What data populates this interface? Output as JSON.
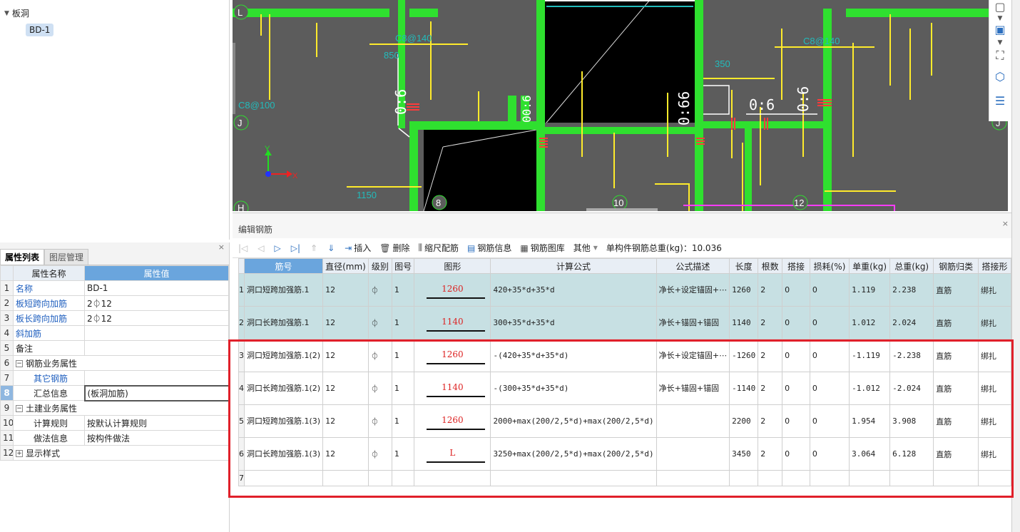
{
  "tree": {
    "root": "板洞",
    "child": "BD-1"
  },
  "props": {
    "tabs": [
      "属性列表",
      "图层管理"
    ],
    "close": "×",
    "header": {
      "name": "属性名称",
      "value": "属性值"
    },
    "rows": [
      {
        "n": "1",
        "name": "名称",
        "value": "BD-1"
      },
      {
        "n": "2",
        "name": "板短跨向加筋",
        "value": "2⏀12"
      },
      {
        "n": "3",
        "name": "板长跨向加筋",
        "value": "2⏀12"
      },
      {
        "n": "4",
        "name": "斜加筋",
        "value": ""
      },
      {
        "n": "5",
        "name": "备注",
        "value": ""
      },
      {
        "n": "6",
        "name": "钢筋业务属性",
        "value": "",
        "exp": "−"
      },
      {
        "n": "7",
        "name": "其它钢筋",
        "value": ""
      },
      {
        "n": "8",
        "name": "汇总信息",
        "value": "(板洞加筋)"
      },
      {
        "n": "9",
        "name": "土建业务属性",
        "value": "",
        "exp": "−"
      },
      {
        "n": "10",
        "name": "计算规则",
        "value": "按默认计算规则"
      },
      {
        "n": "11",
        "name": "做法信息",
        "value": "按构件做法"
      },
      {
        "n": "12",
        "name": "显示样式",
        "value": "",
        "exp": "+"
      }
    ]
  },
  "cad": {
    "axes": {
      "L": "L",
      "J": "J",
      "H": "H",
      "n8": "8",
      "n10": "10",
      "n12": "12",
      "x": "X",
      "y": "Y"
    },
    "dims": {
      "d1": "0:6",
      "d2": "0:66",
      "d3": "0:6",
      "d4": "0:6",
      "d5": "00:6"
    },
    "texts": {
      "t1": "850",
      "t2": "C8@140",
      "t3": "C8@100",
      "t4": "1150",
      "t5": "350",
      "t6": "C8@140"
    }
  },
  "editor": {
    "title": "编辑钢筋",
    "close": "×",
    "toolbar": {
      "insert": "插入",
      "delete": "删除",
      "scale": "缩尺配筋",
      "info": "钢筋信息",
      "library": "钢筋图库",
      "other": "其他",
      "total": "单构件钢筋总重(kg)：10.036"
    },
    "columns": [
      "筋号",
      "直径(mm)",
      "级别",
      "图号",
      "图形",
      "计算公式",
      "公式描述",
      "长度",
      "根数",
      "搭接",
      "损耗(%)",
      "单重(kg)",
      "总重(kg)",
      "钢筋归类",
      "搭接形"
    ],
    "rows": [
      {
        "n": "1",
        "name": "洞口短跨加强筋.1",
        "dia": "12",
        "grade": "⏀",
        "fig": "1",
        "shape": "1260",
        "formula": "420+35*d+35*d",
        "desc": "净长+设定锚固+⋯",
        "len": "1260",
        "cnt": "2",
        "lap": "0",
        "loss": "0",
        "unit": "1.119",
        "total": "2.238",
        "cat": "直筋",
        "join": "绑扎"
      },
      {
        "n": "2",
        "name": "洞口长跨加强筋.1",
        "dia": "12",
        "grade": "⏀",
        "fig": "1",
        "shape": "1140",
        "formula": "300+35*d+35*d",
        "desc": "净长+锚固+锚固",
        "len": "1140",
        "cnt": "2",
        "lap": "0",
        "loss": "0",
        "unit": "1.012",
        "total": "2.024",
        "cat": "直筋",
        "join": "绑扎"
      },
      {
        "n": "3",
        "name": "洞口短跨加强筋.1(2)",
        "dia": "12",
        "grade": "⏀",
        "fig": "1",
        "shape": "1260",
        "formula": "-(420+35*d+35*d)",
        "desc": "净长+设定锚固+⋯",
        "len": "-1260",
        "cnt": "2",
        "lap": "0",
        "loss": "0",
        "unit": "-1.119",
        "total": "-2.238",
        "cat": "直筋",
        "join": "绑扎"
      },
      {
        "n": "4",
        "name": "洞口长跨加强筋.1(2)",
        "dia": "12",
        "grade": "⏀",
        "fig": "1",
        "shape": "1140",
        "formula": "-(300+35*d+35*d)",
        "desc": "净长+锚固+锚固",
        "len": "-1140",
        "cnt": "2",
        "lap": "0",
        "loss": "0",
        "unit": "-1.012",
        "total": "-2.024",
        "cat": "直筋",
        "join": "绑扎"
      },
      {
        "n": "5",
        "name": "洞口短跨加强筋.1(3)",
        "dia": "12",
        "grade": "⏀",
        "fig": "1",
        "shape": "1260",
        "formula": "2000+max(200/2,5*d)+max(200/2,5*d)",
        "desc": "",
        "len": "2200",
        "cnt": "2",
        "lap": "0",
        "loss": "0",
        "unit": "1.954",
        "total": "3.908",
        "cat": "直筋",
        "join": "绑扎"
      },
      {
        "n": "6",
        "name": "洞口长跨加强筋.1(3)",
        "dia": "12",
        "grade": "⏀",
        "fig": "1",
        "shape": "L",
        "formula": "3250+max(200/2,5*d)+max(200/2,5*d)",
        "desc": "",
        "len": "3450",
        "cnt": "2",
        "lap": "0",
        "loss": "0",
        "unit": "3.064",
        "total": "6.128",
        "cat": "直筋",
        "join": "绑扎"
      }
    ],
    "emptyRow": "7"
  }
}
